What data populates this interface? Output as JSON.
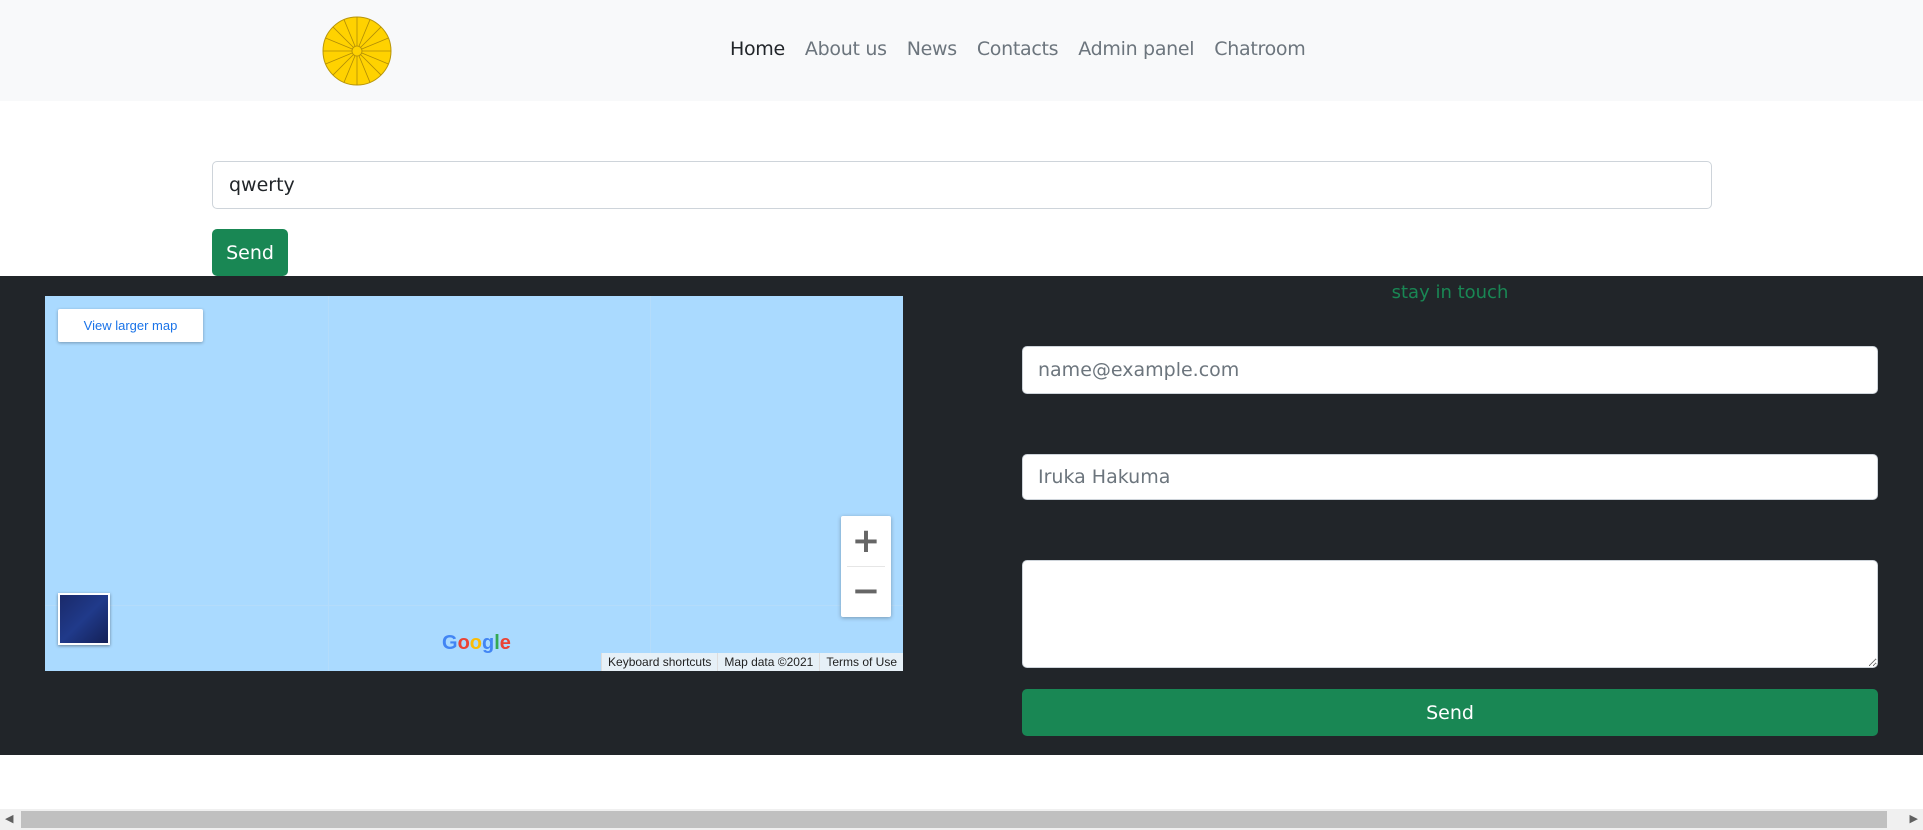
{
  "nav": {
    "items": [
      "Home",
      "About us",
      "News",
      "Contacts",
      "Admin panel",
      "Chatroom"
    ],
    "active": "Home"
  },
  "chat": {
    "input_value": "qwerty",
    "send_label": "Send"
  },
  "map": {
    "view_larger": "View larger map",
    "zoom_in": "+",
    "zoom_out": "−",
    "google": [
      "G",
      "o",
      "o",
      "g",
      "l",
      "e"
    ],
    "attribution": [
      "Keyboard shortcuts",
      "Map data ©2021",
      "Terms of Use"
    ]
  },
  "contact": {
    "heading": "stay in touch",
    "email_placeholder": "name@example.com",
    "name_placeholder": "Iruka Hakuma",
    "message_value": "",
    "send_label": "Send"
  },
  "colors": {
    "accent": "#198754",
    "footer_bg": "#212529",
    "navbar_bg": "#f8f9fa",
    "map_water": "#aadaff"
  }
}
